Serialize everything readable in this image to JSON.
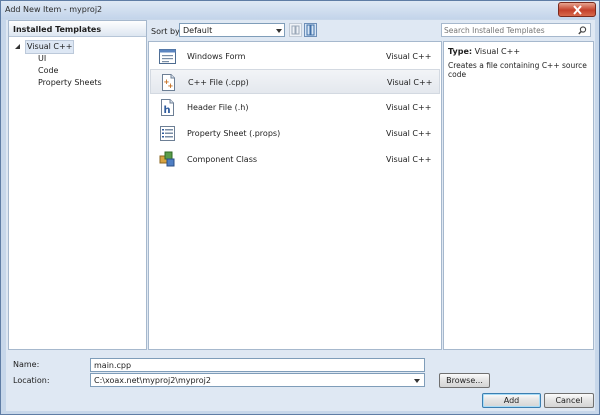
{
  "window": {
    "title": "Add New Item - myproj2"
  },
  "left": {
    "header": "Installed Templates",
    "tree": [
      {
        "label": "Visual C++",
        "level": 0,
        "expanded": true,
        "selected": true
      },
      {
        "label": "UI",
        "level": 1
      },
      {
        "label": "Code",
        "level": 1
      },
      {
        "label": "Property Sheets",
        "level": 1
      }
    ]
  },
  "toolbar": {
    "sort_label": "Sort by:",
    "sort_value": "Default",
    "search_placeholder": "Search Installed Templates"
  },
  "templates": [
    {
      "name": "Windows Form",
      "type": "Visual C++",
      "icon": "windows-form-icon"
    },
    {
      "name": "C++ File (.cpp)",
      "type": "Visual C++",
      "icon": "cpp-file-icon",
      "selected": true
    },
    {
      "name": "Header File (.h)",
      "type": "Visual C++",
      "icon": "header-file-icon"
    },
    {
      "name": "Property Sheet (.props)",
      "type": "Visual C++",
      "icon": "property-sheet-icon"
    },
    {
      "name": "Component Class",
      "type": "Visual C++",
      "icon": "component-class-icon"
    }
  ],
  "description": {
    "type_label": "Type:",
    "type_value": "Visual C++",
    "text": "Creates a file containing C++ source code"
  },
  "form": {
    "name_label": "Name:",
    "name_value": "main.cpp",
    "location_label": "Location:",
    "location_value": "C:\\xoax.net\\myproj2\\myproj2",
    "browse_label": "Browse...",
    "add_label": "Add",
    "cancel_label": "Cancel"
  },
  "colors": {
    "frame": "#c7d7ea",
    "selection": "#e4e8ee",
    "accent": "#3c7fb1"
  }
}
